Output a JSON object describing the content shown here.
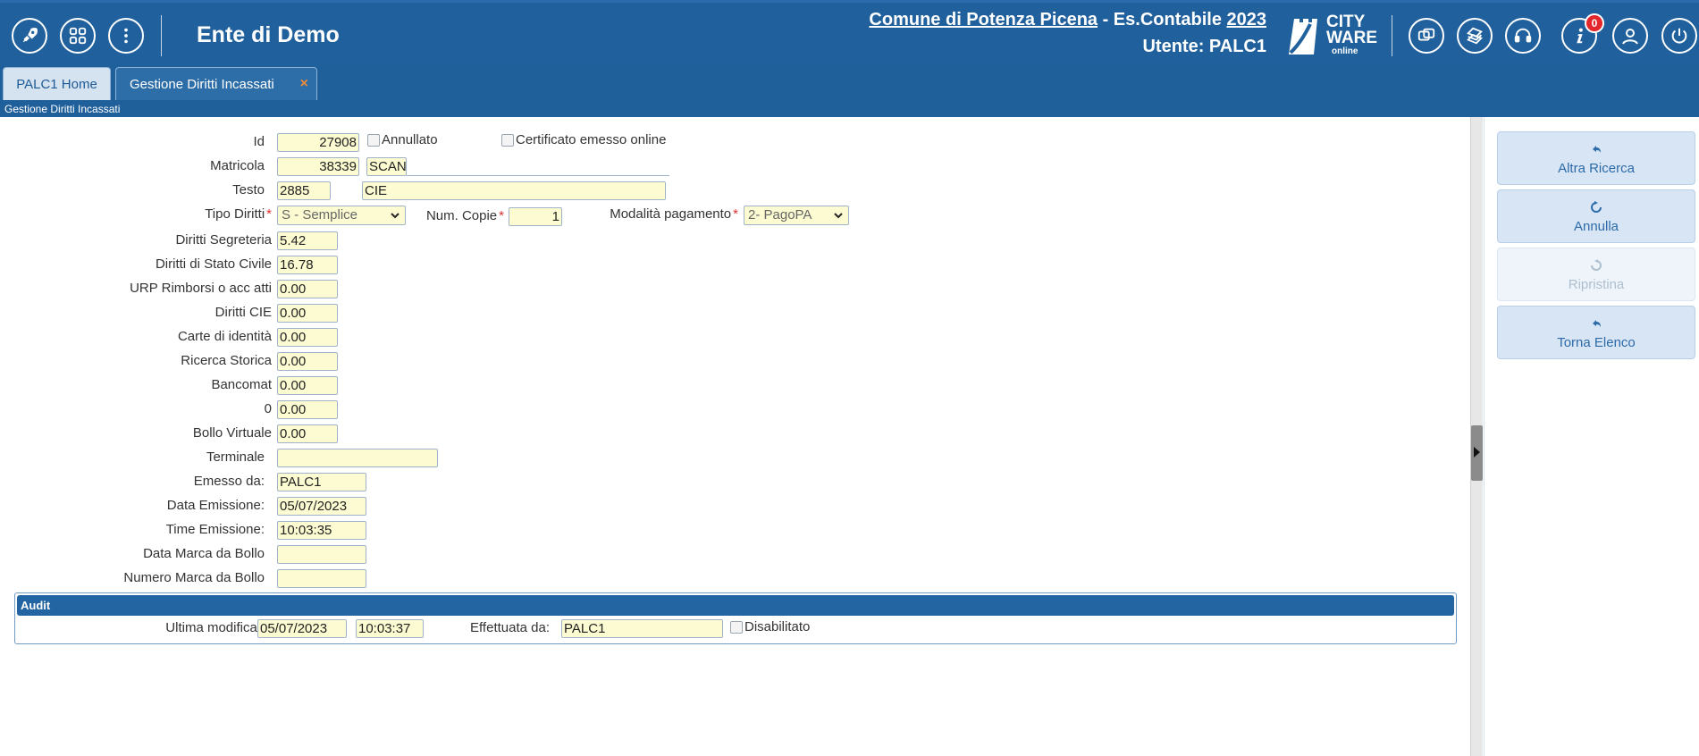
{
  "header": {
    "ente": "Ente di Demo",
    "comune": "Comune di Potenza Picena",
    "es_contabile_label": " - Es.Contabile ",
    "es_contabile_year": "2023",
    "utente": "Utente: PALC1",
    "logo_line1": "CITY",
    "logo_line2": "WARE",
    "logo_line3": "online",
    "notifications_count": "0",
    "colors": {
      "bar": "#20609c",
      "badge": "#e3262b",
      "input_bg": "#fdfbd1"
    }
  },
  "tabs": {
    "home": "PALC1 Home",
    "active": "Gestione Diritti Incassati",
    "close": "×"
  },
  "breadcrumb": "Gestione Diritti Incassati",
  "form": {
    "id_label": "Id",
    "id_value": "27908",
    "annullato_label": "Annullato",
    "certificato_label": "Certificato emesso online",
    "matricola_label": "Matricola",
    "matricola_value": "38339",
    "matricola_name": "SCANI",
    "testo_label": "Testo",
    "testo_code": "2885",
    "testo_value": "CIE",
    "tipo_diritti_label": "Tipo Diritti",
    "tipo_diritti_value": "S - Semplice",
    "num_copie_label": "Num. Copie",
    "num_copie_value": "1",
    "modalita_label": "Modalità pagamento",
    "modalita_value": "2- PagoPA",
    "diritti_segreteria_label": "Diritti Segreteria",
    "diritti_segreteria_value": "5.42",
    "diritti_stato_civile_label": "Diritti di Stato Civile",
    "diritti_stato_civile_value": "16.78",
    "urp_label": "URP Rimborsi o acc atti",
    "urp_value": "0.00",
    "diritti_cie_label": "Diritti CIE",
    "diritti_cie_value": "0.00",
    "carte_label": "Carte di identità",
    "carte_value": "0.00",
    "ricerca_label": "Ricerca Storica",
    "ricerca_value": "0.00",
    "bancomat_label": "Bancomat",
    "bancomat_value": "0.00",
    "zero_label": "0",
    "zero_value": "0.00",
    "bollo_label": "Bollo Virtuale",
    "bollo_value": "0.00",
    "terminale_label": "Terminale",
    "terminale_value": "",
    "emesso_label": "Emesso da:",
    "emesso_value": "PALC1",
    "data_emissione_label": "Data Emissione:",
    "data_emissione_value": "05/07/2023",
    "time_emissione_label": "Time Emissione:",
    "time_emissione_value": "10:03:35",
    "data_marca_label": "Data Marca da Bollo",
    "data_marca_value": "",
    "numero_marca_label": "Numero Marca da Bollo",
    "numero_marca_value": ""
  },
  "audit": {
    "title": "Audit",
    "ultima_label": "Ultima modifica:",
    "ultima_date": "05/07/2023",
    "ultima_time": "10:03:37",
    "effettuata_label": "Effettuata da:",
    "effettuata_value": "PALC1",
    "disabilitato_label": "Disabilitato"
  },
  "actions": {
    "altra_ricerca": "Altra Ricerca",
    "annulla": "Annulla",
    "ripristina": "Ripristina",
    "torna_elenco": "Torna Elenco"
  }
}
